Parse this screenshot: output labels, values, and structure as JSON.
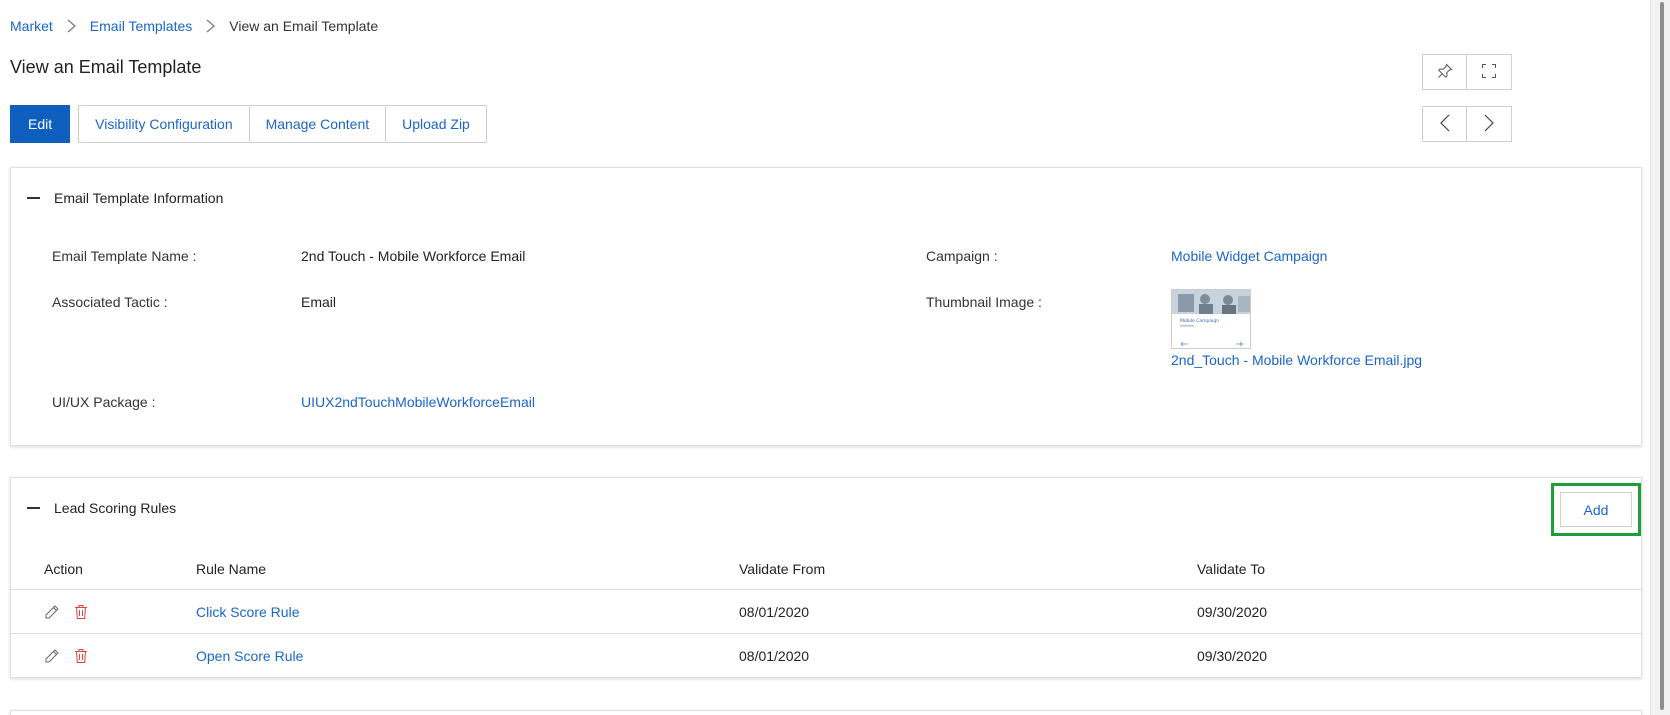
{
  "breadcrumb": {
    "items": [
      "Market",
      "Email Templates",
      "View an Email Template"
    ]
  },
  "page": {
    "title": "View an Email Template"
  },
  "toolbar": {
    "edit": "Edit",
    "visibility": "Visibility Configuration",
    "manage_content": "Manage Content",
    "upload_zip": "Upload Zip"
  },
  "tools": {
    "pin_icon": "pin-icon",
    "fullscreen_icon": "fullscreen-icon",
    "prev_icon": "chevron-left-icon",
    "next_icon": "chevron-right-icon"
  },
  "info_section": {
    "title": "Email Template Information",
    "fields": {
      "name_label": "Email Template Name :",
      "name_value": "2nd Touch - Mobile Workforce Email",
      "campaign_label": "Campaign :",
      "campaign_value": "Mobile Widget Campaign",
      "tactic_label": "Associated Tactic :",
      "tactic_value": "Email",
      "thumbnail_label": "Thumbnail Image :",
      "thumbnail_file": "2nd_Touch - Mobile Workforce Email.jpg",
      "thumbnail_caption": "Mobile Campaign",
      "package_label": "UI/UX Package :",
      "package_value": "UIUX2ndTouchMobileWorkforceEmail"
    }
  },
  "lead_section": {
    "title": "Lead Scoring Rules",
    "add_label": "Add",
    "columns": [
      "Action",
      "Rule Name",
      "Validate From",
      "Validate To"
    ],
    "rows": [
      {
        "name": "Click Score Rule",
        "from": "08/01/2020",
        "to": "09/30/2020"
      },
      {
        "name": "Open Score Rule",
        "from": "08/01/2020",
        "to": "09/30/2020"
      }
    ]
  },
  "colors": {
    "link": "#1a66c8",
    "primary": "#0f5fbf",
    "highlight": "#1f9d3a",
    "delete": "#e0413a"
  }
}
